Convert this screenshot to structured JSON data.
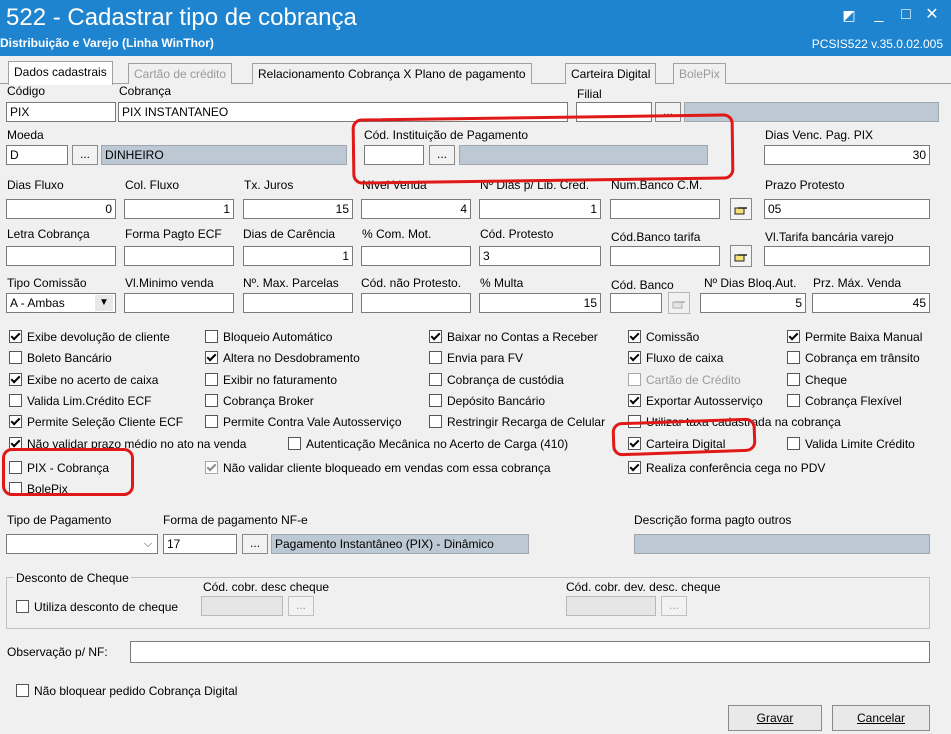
{
  "window": {
    "title": "522 - Cadastrar tipo de cobrança",
    "subtitle": "Distribuição e Varejo (Linha WinThor)",
    "version": "PCSIS522  v.35.0.02.005",
    "controls": {
      "restore": "◩",
      "minimize": "_",
      "maximize": "□",
      "close": "✕"
    }
  },
  "tabs": [
    {
      "label": "Dados cadastrais",
      "state": "active"
    },
    {
      "label": "Cartão de crédito",
      "state": "disabled"
    },
    {
      "label": "Relacionamento Cobrança X Plano de pagamento",
      "state": "enabled"
    },
    {
      "label": "Carteira Digital",
      "state": "enabled"
    },
    {
      "label": "BolePix",
      "state": "disabled"
    }
  ],
  "fields": {
    "codigo": {
      "label": "Código",
      "value": "PIX"
    },
    "cobranca": {
      "label": "Cobrança",
      "value": "PIX INSTANTANEO"
    },
    "filial": {
      "label": "Filial",
      "value": "",
      "button": "...",
      "desc": ""
    },
    "moeda": {
      "label": "Moeda",
      "value": "D",
      "button": "...",
      "desc": "DINHEIRO"
    },
    "cod_instituicao": {
      "label": "Cód. Instituição de Pagamento",
      "value": "",
      "button": "...",
      "desc": ""
    },
    "dias_venc_pix": {
      "label": "Dias Venc. Pag. PIX",
      "value": "30"
    },
    "dias_fluxo": {
      "label": "Dias Fluxo",
      "value": "0"
    },
    "col_fluxo": {
      "label": "Col. Fluxo",
      "value": "1"
    },
    "tx_juros": {
      "label": "Tx. Juros",
      "value": "15"
    },
    "nivel_venda": {
      "label": "Nível Venda",
      "value": "4"
    },
    "dias_lib_cred": {
      "label": "Nº Dias p/ Lib. Cred.",
      "value": "1"
    },
    "num_banco_cm": {
      "label": "Num.Banco C.M.",
      "value": ""
    },
    "prazo_protesto": {
      "label": "Prazo Protesto",
      "value": "05"
    },
    "letra_cobranca": {
      "label": "Letra Cobrança",
      "value": ""
    },
    "forma_pagto_ecf": {
      "label": "Forma Pagto ECF",
      "value": ""
    },
    "dias_carencia": {
      "label": "Dias de Carência",
      "value": "1"
    },
    "com_mot": {
      "label": "% Com. Mot.",
      "value": ""
    },
    "cod_protesto": {
      "label": "Cód. Protesto",
      "value": "3"
    },
    "cod_banco_tarifa": {
      "label": "Cód.Banco tarifa",
      "value": ""
    },
    "vl_tarifa": {
      "label": "Vl.Tarifa bancária varejo",
      "value": ""
    },
    "tipo_comissao": {
      "label": "Tipo Comissão",
      "value": "A - Ambas"
    },
    "vl_minimo": {
      "label": "Vl.Minimo venda",
      "value": ""
    },
    "max_parcelas": {
      "label": "Nº. Max. Parcelas",
      "value": ""
    },
    "cod_nao_protesto": {
      "label": "Cód. não Protesto.",
      "value": ""
    },
    "multa": {
      "label": "% Multa",
      "value": "15"
    },
    "cod_banco": {
      "label": "Cód. Banco",
      "value": ""
    },
    "dias_bloq_aut": {
      "label": "Nº Dias Bloq.Aut.",
      "value": "5"
    },
    "prz_max_venda": {
      "label": "Prz. Máx. Venda",
      "value": "45"
    }
  },
  "checkboxes": [
    {
      "id": "exibe-devolucao",
      "label": "Exibe devolução de cliente",
      "checked": true,
      "disabled": false
    },
    {
      "id": "bloqueio-automatico",
      "label": "Bloqueio Automático",
      "checked": false,
      "disabled": false
    },
    {
      "id": "baixar-contas",
      "label": "Baixar no Contas a Receber",
      "checked": true,
      "disabled": false
    },
    {
      "id": "comissao",
      "label": "Comissão",
      "checked": true,
      "disabled": false
    },
    {
      "id": "permite-baixa-manual",
      "label": "Permite Baixa Manual",
      "checked": true,
      "disabled": false
    },
    {
      "id": "boleto-bancario",
      "label": "Boleto Bancário",
      "checked": false,
      "disabled": false
    },
    {
      "id": "altera-desdobramento",
      "label": "Altera no Desdobramento",
      "checked": true,
      "disabled": false
    },
    {
      "id": "envia-fv",
      "label": "Envia para FV",
      "checked": false,
      "disabled": false
    },
    {
      "id": "fluxo-caixa",
      "label": "Fluxo de caixa",
      "checked": true,
      "disabled": false
    },
    {
      "id": "cobranca-transito",
      "label": "Cobrança em trânsito",
      "checked": false,
      "disabled": false
    },
    {
      "id": "exibe-acerto-caixa",
      "label": "Exibe no acerto de caixa",
      "checked": true,
      "disabled": false
    },
    {
      "id": "exibir-faturamento",
      "label": "Exibir no faturamento",
      "checked": false,
      "disabled": false
    },
    {
      "id": "cobranca-custodia",
      "label": "Cobrança de custódia",
      "checked": false,
      "disabled": false
    },
    {
      "id": "cartao-credito",
      "label": "Cartão de Crédito",
      "checked": false,
      "disabled": true
    },
    {
      "id": "cheque",
      "label": "Cheque",
      "checked": false,
      "disabled": false
    },
    {
      "id": "valida-lim-credito",
      "label": "Valida Lim.Crédito ECF",
      "checked": false,
      "disabled": false
    },
    {
      "id": "cobranca-broker",
      "label": "Cobrança Broker",
      "checked": false,
      "disabled": false
    },
    {
      "id": "deposito-bancario",
      "label": "Depósito Bancário",
      "checked": false,
      "disabled": false
    },
    {
      "id": "exportar-autosservico",
      "label": "Exportar Autosserviço",
      "checked": true,
      "disabled": false
    },
    {
      "id": "cobranca-flexivel",
      "label": "Cobrança Flexível",
      "checked": false,
      "disabled": false
    },
    {
      "id": "permite-selecao-cliente",
      "label": "Permite Seleção Cliente ECF",
      "checked": true,
      "disabled": false
    },
    {
      "id": "permite-contra-vale",
      "label": "Permite Contra Vale Autosserviço",
      "checked": false,
      "disabled": false
    },
    {
      "id": "restringir-recarga",
      "label": "Restringir Recarga de Celular",
      "checked": false,
      "disabled": false
    },
    {
      "id": "utilizar-taxa",
      "label": "Utilizar taxa cadastrada na cobrança",
      "checked": false,
      "disabled": false
    },
    {
      "id": "nao-validar-prazo",
      "label": "Não validar prazo médio no ato na venda",
      "checked": true,
      "disabled": false
    },
    {
      "id": "autenticacao-mecanica",
      "label": "Autenticação Mecânica no Acerto de Carga (410)",
      "checked": false,
      "disabled": false
    },
    {
      "id": "carteira-digital",
      "label": "Carteira Digital",
      "checked": true,
      "disabled": false
    },
    {
      "id": "valida-limite-credito",
      "label": "Valida Limite Crédito",
      "checked": false,
      "disabled": false
    },
    {
      "id": "pix-cobranca",
      "label": "PIX - Cobrança",
      "checked": false,
      "disabled": false
    },
    {
      "id": "nao-validar-bloqueado",
      "label": "Não validar cliente bloqueado em vendas com essa cobrança",
      "checked": true,
      "disabled": true
    },
    {
      "id": "realiza-conferencia-cega",
      "label": "Realiza conferência cega no PDV",
      "checked": true,
      "disabled": false
    },
    {
      "id": "bolepix",
      "label": "BolePix",
      "checked": false,
      "disabled": false
    }
  ],
  "pagamento": {
    "tipo_label": "Tipo de Pagamento",
    "tipo_value": "",
    "forma_label": "Forma de pagamento NF-e",
    "forma_value": "17",
    "forma_button": "...",
    "forma_desc": "Pagamento Instantâneo (PIX) - Dinâmico",
    "outros_label": "Descrição forma pagto outros",
    "outros_value": ""
  },
  "desconto_cheque": {
    "title": "Desconto de Cheque",
    "utiliza_label": "Utiliza desconto de cheque",
    "utiliza_checked": false,
    "cod_desc_label": "Cód. cobr. desc cheque",
    "cod_dev_label": "Cód. cobr. dev. desc. cheque",
    "button": "..."
  },
  "observacao": {
    "label": "Observação p/ NF:",
    "value": ""
  },
  "nao_bloquear": {
    "label": "Não bloquear pedido Cobrança Digital",
    "checked": false
  },
  "actions": {
    "save": "Gravar",
    "cancel": "Cancelar"
  },
  "colors": {
    "titlebar": "#1e84d0",
    "readonly": "#bcc8d3",
    "highlight": "#e01818"
  }
}
